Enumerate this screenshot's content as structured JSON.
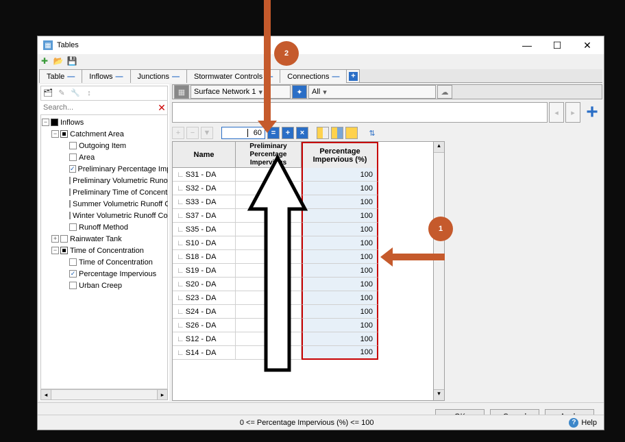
{
  "window_title": "Tables",
  "tabs": [
    "Table",
    "Inflows",
    "Junctions",
    "Stormwater Controls",
    "Connections"
  ],
  "left": {
    "search_placeholder": "Search...",
    "tree": {
      "root": "Inflows",
      "catchment": "Catchment Area",
      "items": [
        "Outgoing Item",
        "Area",
        "Preliminary Percentage Impervious",
        "Preliminary Volumetric Runoff Coefficient",
        "Preliminary Time of Concentration",
        "Summer Volumetric Runoff Coefficient",
        "Winter Volumetric Runoff Coefficient",
        "Runoff Method"
      ],
      "rainwater": "Rainwater Tank",
      "toc": "Time of Concentration",
      "toc_items": [
        "Time of Concentration",
        "Percentage Impervious",
        "Urban Creep"
      ]
    }
  },
  "right": {
    "network": "Surface Network 1",
    "scope": "All",
    "input_value": "60",
    "headers": [
      "Name",
      "Preliminary Percentage Impervious",
      "Percentage Impervious (%)"
    ],
    "rows": [
      {
        "name": "S31 - DA",
        "p1": "",
        "p2": "100"
      },
      {
        "name": "S32 - DA",
        "p1": "",
        "p2": "100"
      },
      {
        "name": "S33 - DA",
        "p1": "",
        "p2": "100"
      },
      {
        "name": "S37 - DA",
        "p1": "",
        "p2": "100"
      },
      {
        "name": "S35 - DA",
        "p1": "",
        "p2": "100"
      },
      {
        "name": "S10 - DA",
        "p1": "",
        "p2": "100"
      },
      {
        "name": "S18 - DA",
        "p1": "",
        "p2": "100"
      },
      {
        "name": "S19 - DA",
        "p1": "",
        "p2": "100"
      },
      {
        "name": "S20 - DA",
        "p1": "",
        "p2": "100"
      },
      {
        "name": "S23 - DA",
        "p1": "",
        "p2": "100"
      },
      {
        "name": "S24 - DA",
        "p1": "",
        "p2": "100"
      },
      {
        "name": "S26 - DA",
        "p1": "",
        "p2": "100"
      },
      {
        "name": "S12 - DA",
        "p1": "",
        "p2": "100"
      },
      {
        "name": "S14 - DA",
        "p1": "",
        "p2": "100"
      }
    ]
  },
  "buttons": {
    "ok": "OK",
    "cancel": "Cancel",
    "apply": "Apply",
    "help": "Help"
  },
  "status": "0 <= Percentage Impervious (%) <= 100",
  "anno": {
    "one": "1",
    "two": "2"
  }
}
